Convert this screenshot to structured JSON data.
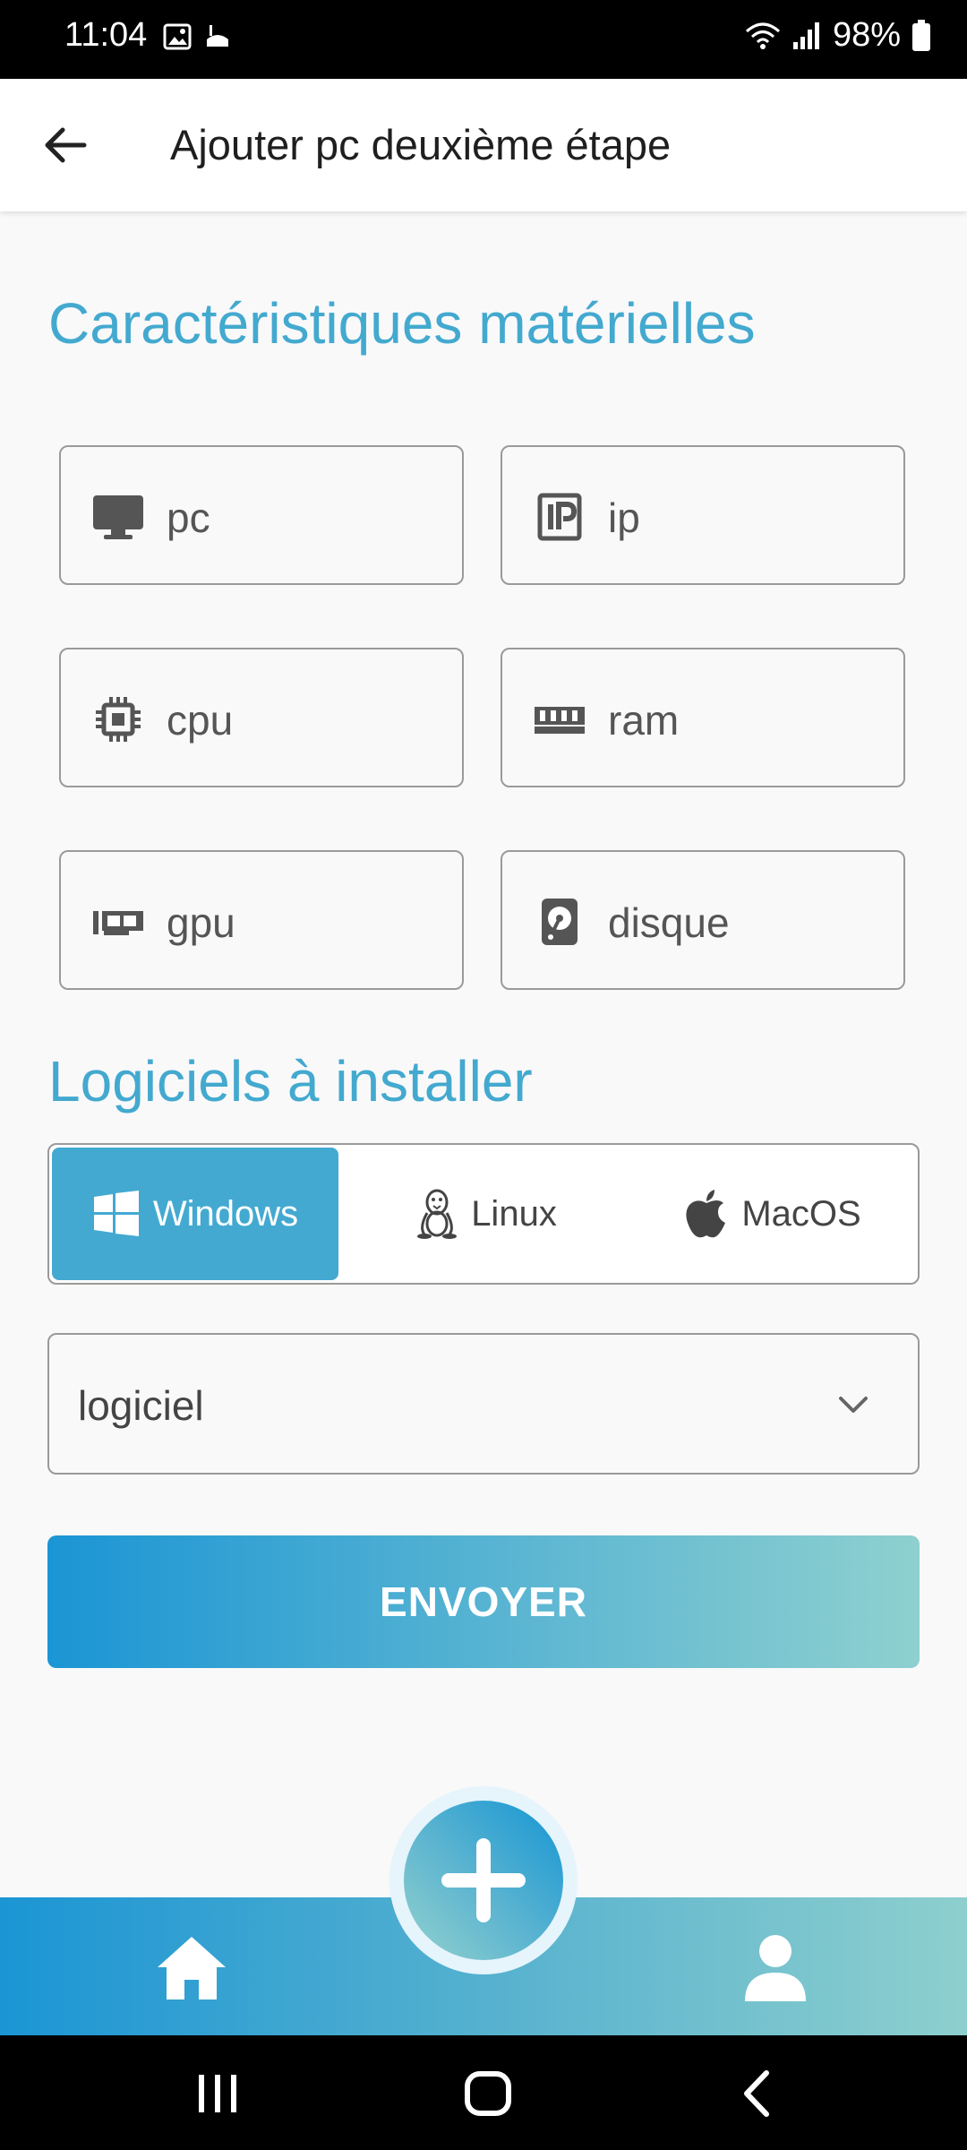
{
  "status_bar": {
    "time": "11:04",
    "battery": "98%"
  },
  "app_bar": {
    "title": "Ajouter pc deuxième étape"
  },
  "hardware": {
    "title": "Caractéristiques matérielles",
    "fields": [
      {
        "label": "pc",
        "icon": "monitor-icon"
      },
      {
        "label": "ip",
        "icon": "ip-icon"
      },
      {
        "label": "cpu",
        "icon": "cpu-icon"
      },
      {
        "label": "ram",
        "icon": "ram-icon"
      },
      {
        "label": "gpu",
        "icon": "gpu-icon"
      },
      {
        "label": "disque",
        "icon": "disk-icon"
      }
    ]
  },
  "software": {
    "title": "Logiciels à installer",
    "os_options": [
      {
        "label": "Windows",
        "icon": "windows-icon",
        "selected": true
      },
      {
        "label": "Linux",
        "icon": "linux-icon",
        "selected": false
      },
      {
        "label": "MacOS",
        "icon": "apple-icon",
        "selected": false
      }
    ],
    "dropdown_label": "logiciel"
  },
  "submit_label": "ENVOYER",
  "colors": {
    "accent": "#43a9cf",
    "gradient_start": "#1b95d4",
    "gradient_end": "#8ed0cf"
  }
}
